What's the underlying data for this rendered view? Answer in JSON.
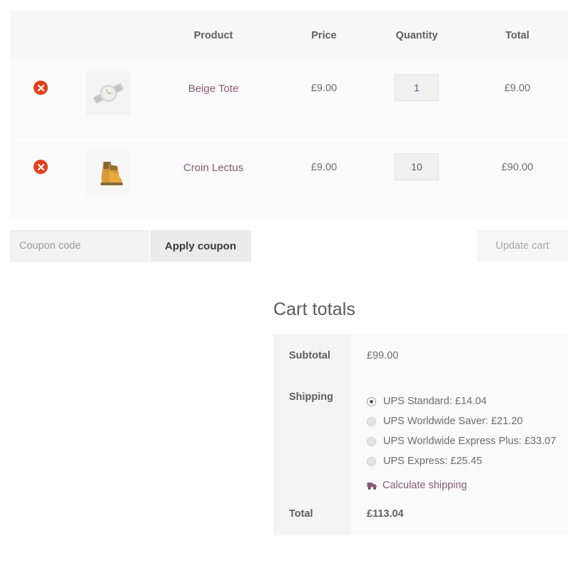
{
  "cart_table": {
    "columns": [
      {
        "key": "remove",
        "label": ""
      },
      {
        "key": "thumb",
        "label": ""
      },
      {
        "key": "name",
        "label": "Product"
      },
      {
        "key": "price",
        "label": "Price"
      },
      {
        "key": "quantity",
        "label": "Quantity"
      },
      {
        "key": "total",
        "label": "Total"
      }
    ],
    "rows": [
      {
        "remove_label": "×",
        "thumbnail": "wristwatch-thumbnail",
        "name": "Beige Tote",
        "price": "£9.00",
        "quantity": "1",
        "total": "£9.00"
      },
      {
        "remove_label": "×",
        "thumbnail": "boots-thumbnail",
        "name": "Croin Lectus",
        "price": "£9.00",
        "quantity": "10",
        "total": "£90.00"
      }
    ]
  },
  "actions": {
    "coupon_value": "",
    "coupon_placeholder": "Coupon code",
    "apply_label": "Apply coupon",
    "update_label": "Update cart"
  },
  "totals": {
    "title": "Cart totals",
    "subtotal_label": "Subtotal",
    "subtotal_value": "£99.00",
    "shipping_label": "Shipping",
    "shipping_options": [
      {
        "label": "UPS Standard: £14.04",
        "selected": true
      },
      {
        "label": "UPS Worldwide Saver: £21.20",
        "selected": false
      },
      {
        "label": "UPS Worldwide Express Plus: £33.07",
        "selected": false
      },
      {
        "label": "UPS Express: £25.45",
        "selected": false
      }
    ],
    "calculate_shipping_label": "Calculate shipping",
    "total_label": "Total",
    "total_value": "£113.04"
  },
  "colors": {
    "link": "#8a5a78",
    "remove_button": "#e2401c",
    "header_bg": "#f7f7f7",
    "row_bg": "#fafafa",
    "text": "#6d6d6d"
  }
}
